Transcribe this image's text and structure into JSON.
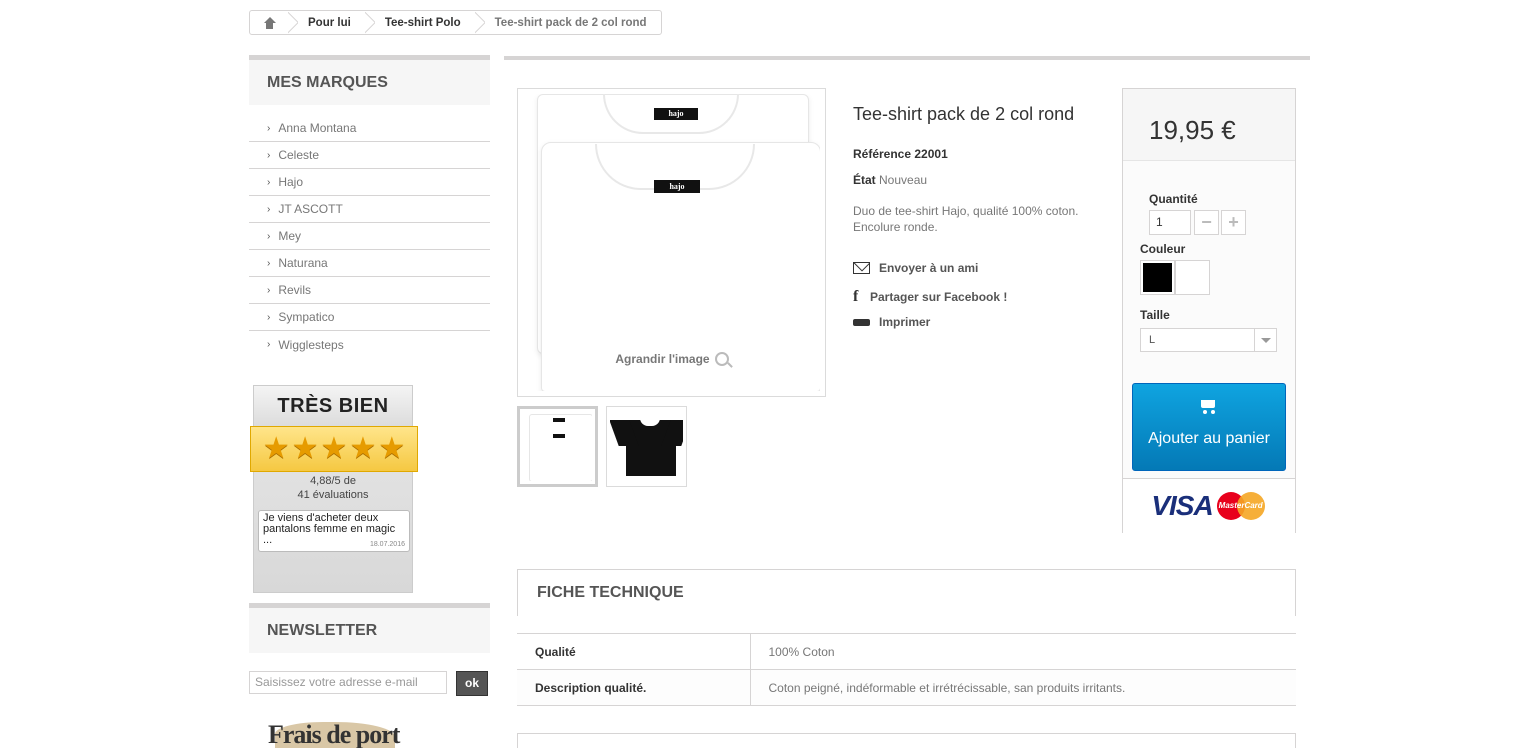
{
  "breadcrumb": {
    "items": [
      "Pour lui",
      "Tee-shirt Polo",
      "Tee-shirt pack de 2 col rond"
    ]
  },
  "sidebar": {
    "brands_title": "MES MARQUES",
    "brands": [
      "Anna Montana",
      "Celeste",
      "Hajo",
      "JT ASCOTT",
      "Mey",
      "Naturana",
      "Revils",
      "Sympatico",
      "Wigglesteps"
    ],
    "rating": {
      "title": "TRÈS BIEN",
      "stars": 5,
      "score_line1": "4,88/5 de",
      "score_line2": "41 évaluations",
      "review_text": "Je viens d'acheter deux  pantalons femme en magic ...",
      "review_date": "18.07.2016"
    },
    "newsletter_title": "NEWSLETTER",
    "newsletter_placeholder": "Saisissez votre adresse e-mail",
    "newsletter_button": "ok",
    "shipping_promo": "Frais de port"
  },
  "product": {
    "title": "Tee-shirt pack de 2 col rond",
    "reference_label": "Référence",
    "reference_value": "22001",
    "condition_label": "État",
    "condition_value": "Nouveau",
    "description": "Duo de tee-shirt Hajo, qualité 100% coton. Encolure ronde.",
    "enlarge_label": "Agrandir l'image",
    "tag_label": "hajo",
    "actions": {
      "send_friend": "Envoyer à un ami",
      "facebook": "Partager sur Facebook !",
      "print": "Imprimer"
    }
  },
  "buybox": {
    "price": "19,95 €",
    "quantity_label": "Quantité",
    "quantity_value": "1",
    "color_label": "Couleur",
    "colors": [
      "#000000",
      "#ffffff"
    ],
    "size_label": "Taille",
    "size_value": "L",
    "add_to_cart": "Ajouter au panier",
    "visa": "VISA",
    "mastercard": "MasterCard"
  },
  "fiche": {
    "title": "FICHE TECHNIQUE",
    "rows": [
      {
        "key": "Qualité",
        "value": "100% Coton"
      },
      {
        "key": "Description qualité.",
        "value": "Coton peigné, indéformable et irrétrécissable, san produits irritants."
      }
    ]
  },
  "colors": {
    "cart_button": "#0b8ec8",
    "border": "#d6d4d4"
  }
}
